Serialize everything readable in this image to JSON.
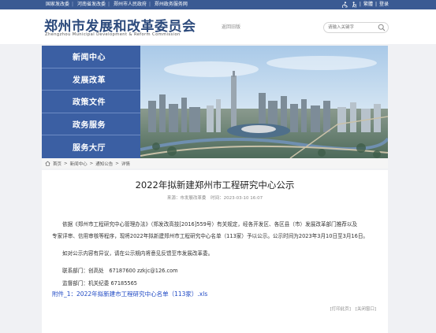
{
  "topbar": {
    "links": [
      "国家发改委",
      "河南省发改委",
      "郑州市人民政府",
      "郑州政务服务网"
    ],
    "right_links": [
      "繁體",
      "登录"
    ]
  },
  "header": {
    "title_cn": "郑州市发展和改革委员会",
    "title_en": "Zhengzhou Municipal Development & Reform Commission",
    "old_site": "返回旧版",
    "search_placeholder": "请输入关键字"
  },
  "nav": {
    "items": [
      "新闻中心",
      "发展改革",
      "政策文件",
      "政务服务",
      "服务大厅"
    ]
  },
  "breadcrumb": {
    "items": [
      "首页",
      "新闻中心",
      "通知公告",
      "详情"
    ],
    "separator": ">"
  },
  "article": {
    "title": "2022年拟新建郑州市工程研究中心公示",
    "source_label": "来源：市发展改革委",
    "time_label": "时间：2023-03-10 16:07",
    "para1_line1": "依据《郑州市工程研究中心管理办法》（郑发改高技[2016]559号）有关规定，经各开发区、各区县（市）发展改革部门推荐以及",
    "para1_line2": "专家评审、信用审核等程序，现将2022年拟新建郑州市工程研究中心名单（113家）予以公示。公示时间为2023年3月10日至3月16日。",
    "para2": "如对公示内容有异议，请在公示期内将意见反馈至市发展改革委。",
    "contact": "联系部门：创高处　67187600  zzkjc@126.com",
    "supervise": "监督部门：机关纪委 67185565",
    "attachment": "附件_1：2022年拟新建市工程研究中心名单（113家）.xls",
    "print": "[打印此页]",
    "close": "[关闭窗口]"
  },
  "colors": {
    "brand": "#3a5a93",
    "nav_bg": "#3b5fa3",
    "link": "#1f49c4"
  }
}
